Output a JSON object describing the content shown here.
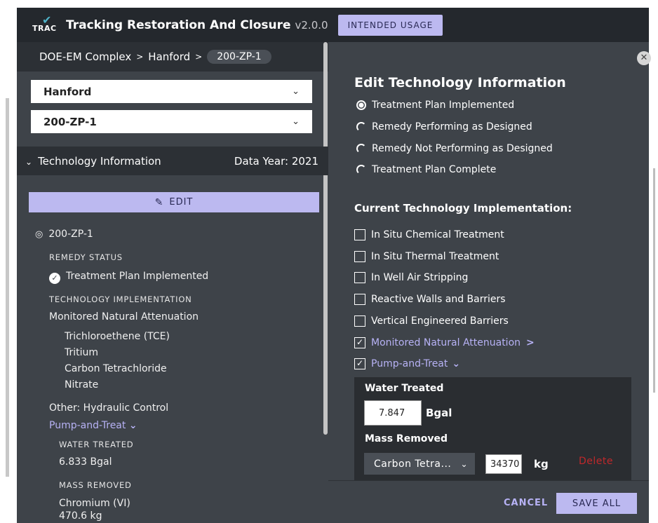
{
  "header": {
    "logo_text": "TRAC",
    "title": "Tracking Restoration And Closure",
    "version": "v2.0.0",
    "usage_button": "INTENDED USAGE"
  },
  "breadcrumb": {
    "item1": "DOE-EM Complex",
    "item2": "Hanford",
    "current": "200-ZP-1",
    "sep": ">"
  },
  "dropdowns": {
    "site": "Hanford",
    "unit": "200-ZP-1",
    "chevron": "⌄"
  },
  "tech_section": {
    "title": "Technology Information",
    "chevron": "⌄",
    "data_year": "Data Year: 2021",
    "edit_label": "EDIT",
    "location": "200-ZP-1",
    "remedy_status_label": "REMEDY STATUS",
    "remedy_status_value": "Treatment Plan Implemented",
    "tech_impl_label": "TECHNOLOGY IMPLEMENTATION",
    "mna_title": "Monitored Natural Attenuation",
    "contaminants": [
      "Trichloroethene (TCE)",
      "Tritium",
      "Carbon Tetrachloride",
      "Nitrate"
    ],
    "other": "Other: Hydraulic Control",
    "pump_treat": "Pump-and-Treat",
    "water_treated_label": "WATER TREATED",
    "water_treated_value": "6.833 Bgal",
    "mass_removed_label": "MASS REMOVED",
    "mass_item": "Chromium (VI)",
    "mass_value": "470.6 kg"
  },
  "edit_panel": {
    "title": "Edit Technology Information",
    "radios": [
      {
        "label": "Treatment Plan Implemented",
        "selected": true
      },
      {
        "label": "Remedy Performing as Designed",
        "selected": false
      },
      {
        "label": "Remedy Not Performing as Designed",
        "selected": false
      },
      {
        "label": "Treatment Plan Complete",
        "selected": false
      }
    ],
    "current_impl_title": "Current Technology Implementation:",
    "checkboxes": [
      {
        "label": "In Situ Chemical Treatment",
        "checked": false
      },
      {
        "label": "In Situ Thermal Treatment",
        "checked": false
      },
      {
        "label": "In Well Air Stripping",
        "checked": false
      },
      {
        "label": "Reactive Walls and Barriers",
        "checked": false
      },
      {
        "label": "Vertical Engineered Barriers",
        "checked": false
      },
      {
        "label": "Monitored Natural Attenuation",
        "checked": true
      },
      {
        "label": "Pump-and-Treat",
        "checked": true
      }
    ],
    "water_treated_label": "Water Treated",
    "water_treated_value": "7.847",
    "water_unit": "Bgal",
    "mass_removed_label": "Mass Removed",
    "mass_select": "Carbon Tetra...",
    "mass_value": "34370",
    "mass_unit": "kg",
    "delete_label": "Delete",
    "cancel_label": "CANCEL",
    "save_label": "SAVE ALL",
    "close_symbol": "✕"
  }
}
